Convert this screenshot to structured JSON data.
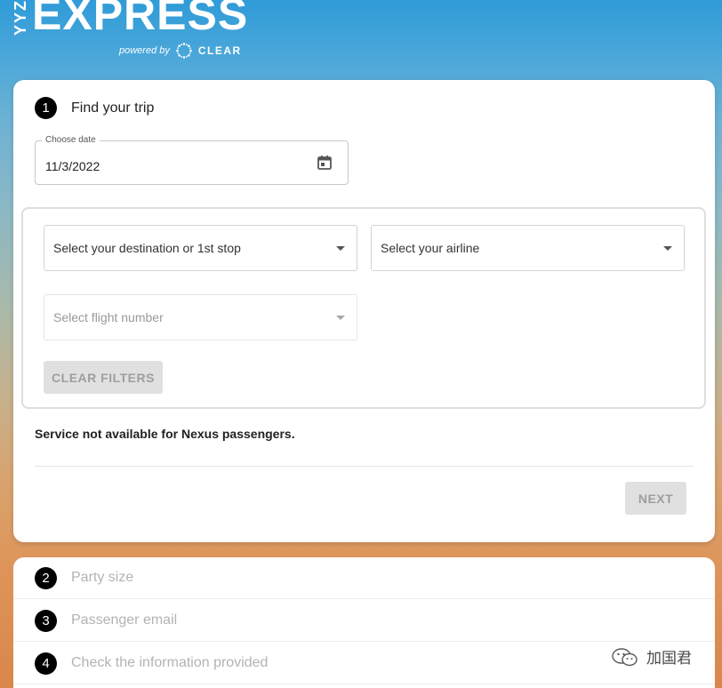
{
  "brand": {
    "side_text": "YYZ",
    "main_text": "EXPRESS",
    "powered_by": "powered by",
    "partner": "CLEAR"
  },
  "step1": {
    "number": "1",
    "title": "Find your trip",
    "date": {
      "legend": "Choose date",
      "value": "11/3/2022"
    },
    "destination_select": "Select your destination or 1st stop",
    "airline_select": "Select your airline",
    "flight_select": "Select flight number",
    "clear_filters": "CLEAR FILTERS",
    "notice": "Service not available for Nexus passengers.",
    "next": "NEXT"
  },
  "steps": [
    {
      "number": "2",
      "label": "Party size"
    },
    {
      "number": "3",
      "label": "Passenger email"
    },
    {
      "number": "4",
      "label": "Check the information provided"
    }
  ],
  "watermark": {
    "text": "加国君"
  },
  "colors": {
    "step_badge": "#000000",
    "disabled_button_bg": "#e0e0e0",
    "disabled_button_text": "#9e9e9e",
    "sky_top": "#2f9bd8",
    "sky_bottom": "#d9864a"
  }
}
